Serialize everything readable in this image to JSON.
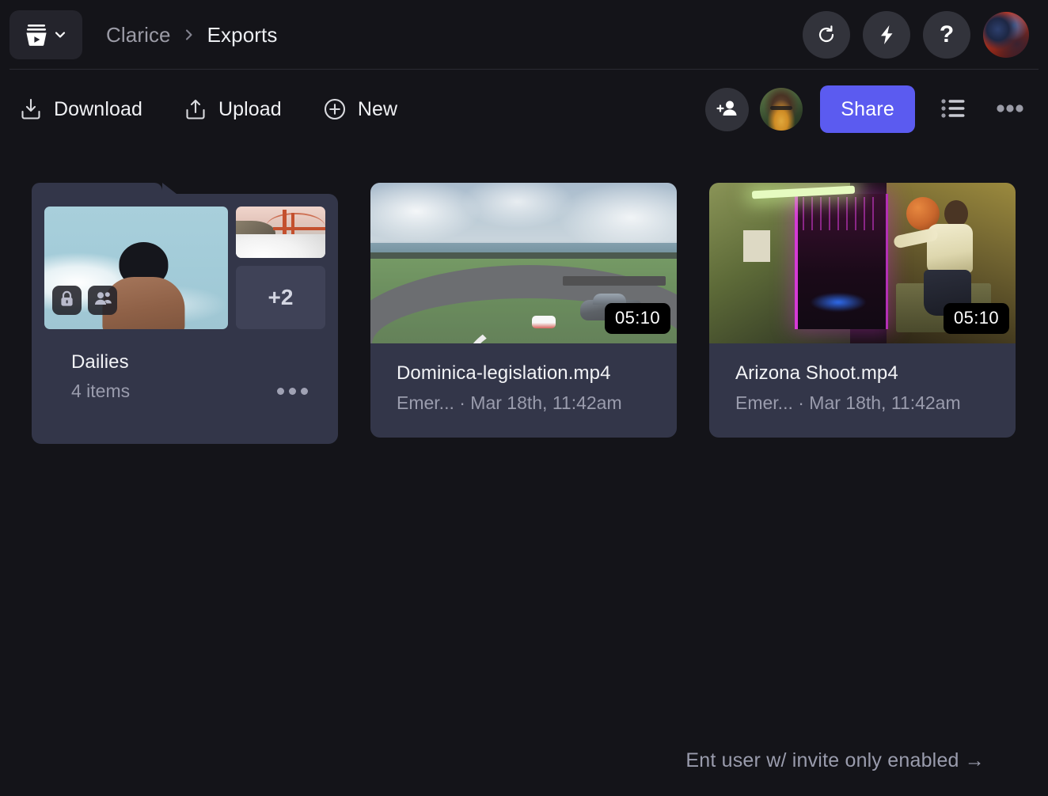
{
  "topbar": {
    "logo_icon": "frameio-logo-icon",
    "switcher_chevron_icon": "chevron-down-icon",
    "breadcrumb": {
      "root": "Clarice",
      "separator_icon": "chevron-right-icon",
      "current": "Exports"
    },
    "buttons": [
      {
        "name": "refresh",
        "icon": "refresh-icon",
        "label": ""
      },
      {
        "name": "lightning",
        "icon": "lightning-bolt-icon",
        "label": ""
      },
      {
        "name": "help",
        "icon": "question-mark-icon",
        "label": "?"
      }
    ],
    "avatar": {
      "name": "user-avatar",
      "accent": "#c2391f"
    }
  },
  "actionbar": {
    "download_label": "Download",
    "download_icon": "download-icon",
    "upload_label": "Upload",
    "upload_icon": "upload-icon",
    "new_label": "New",
    "new_icon": "plus-circle-icon",
    "invite_icon": "add-person-icon",
    "collaborator_avatar": "collaborator-avatar",
    "share_label": "Share",
    "share_color": "#5b5bf0",
    "list_view_icon": "list-view-icon",
    "more_icon": "more-horizontal-icon"
  },
  "grid": {
    "folder": {
      "name": "Dailies",
      "item_count": "4 items",
      "overflow_count": "+2",
      "badges": [
        "lock-icon",
        "people-icon"
      ],
      "more_icon": "more-horizontal-icon"
    },
    "assets": [
      {
        "name": "Dominica-legislation.mp4",
        "subtitle": "Emer... · Mar 18th, 11:42am",
        "duration": "05:10",
        "thumb": "racetrack-thumbnail"
      },
      {
        "name": "Arizona Shoot.mp4",
        "subtitle": "Emer... · Mar 18th, 11:42am",
        "duration": "05:10",
        "thumb": "neon-studio-thumbnail"
      }
    ]
  },
  "footer": {
    "note": "Ent user w/ invite only enabled →"
  },
  "theme": {
    "page_bg": "#141419",
    "card_bg": "#333649",
    "accent": "#5b5bf0",
    "text_primary": "#f2f3f6",
    "text_secondary": "#9a9cad"
  }
}
